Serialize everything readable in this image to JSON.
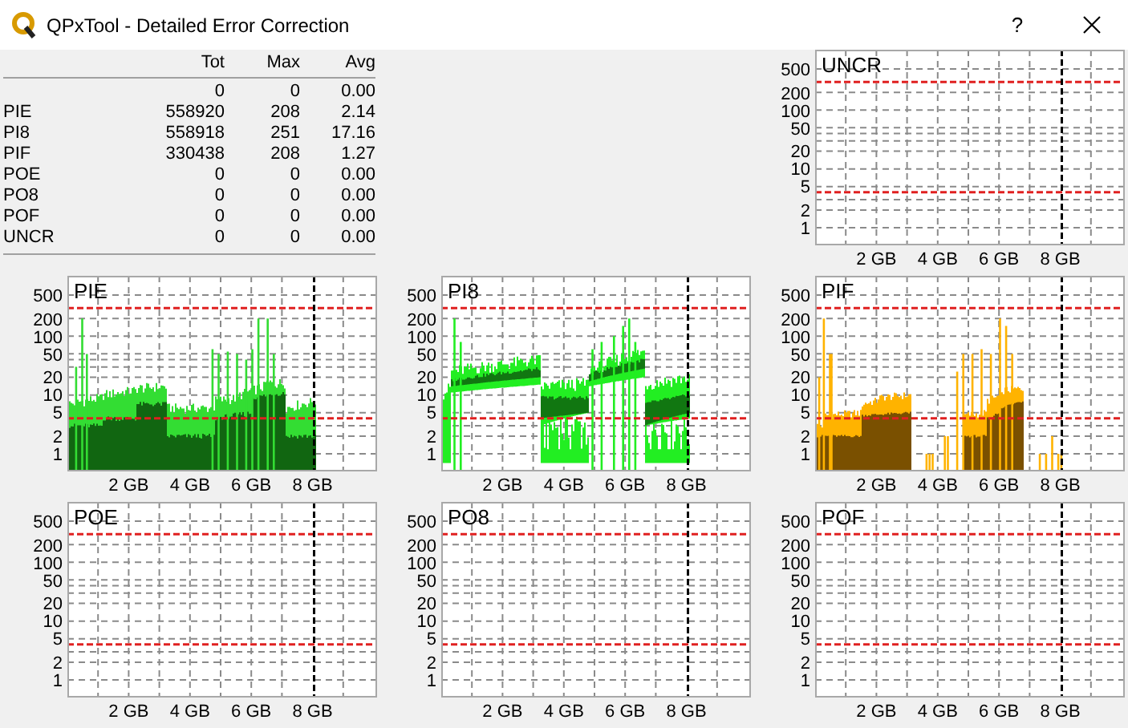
{
  "window": {
    "title": "QPxTool - Detailed Error Correction",
    "help": "?"
  },
  "summary": {
    "columns": [
      "Tot",
      "Max",
      "Avg"
    ],
    "rows": [
      {
        "tot": "0",
        "max": "0",
        "avg": "0.00"
      },
      {
        "label": "PIE",
        "tot": "558920",
        "max": "208",
        "avg": "2.14"
      },
      {
        "label": "PI8",
        "tot": "558918",
        "max": "251",
        "avg": "17.16"
      },
      {
        "label": "PIF",
        "tot": "330438",
        "max": "208",
        "avg": "1.27"
      },
      {
        "label": "POE",
        "tot": "0",
        "max": "0",
        "avg": "0.00"
      },
      {
        "label": "PO8",
        "tot": "0",
        "max": "0",
        "avg": "0.00"
      },
      {
        "label": "POF",
        "tot": "0",
        "max": "0",
        "avg": "0.00"
      },
      {
        "label": "UNCR",
        "tot": "0",
        "max": "0",
        "avg": "0.00"
      }
    ]
  },
  "charts": [
    {
      "title": "UNCR",
      "kind": "empty",
      "yticks": [
        "500",
        "200",
        "100",
        "50",
        "20",
        "10",
        "5",
        "2",
        "1"
      ],
      "xticks": [
        "2 GB",
        "4 GB",
        "6 GB",
        "8 GB"
      ]
    },
    {
      "title": "PIE",
      "kind": "pie",
      "yticks": [
        "500",
        "200",
        "100",
        "50",
        "20",
        "10",
        "5",
        "2",
        "1"
      ],
      "xticks": [
        "2 GB",
        "4 GB",
        "6 GB",
        "8 GB"
      ]
    },
    {
      "title": "PI8",
      "kind": "pi8",
      "yticks": [
        "500",
        "200",
        "100",
        "50",
        "20",
        "10",
        "5",
        "2",
        "1"
      ],
      "xticks": [
        "2 GB",
        "4 GB",
        "6 GB",
        "8 GB"
      ]
    },
    {
      "title": "PIF",
      "kind": "pif",
      "yticks": [
        "500",
        "200",
        "100",
        "50",
        "20",
        "10",
        "5",
        "2",
        "1"
      ],
      "xticks": [
        "2 GB",
        "4 GB",
        "6 GB",
        "8 GB"
      ]
    },
    {
      "title": "POE",
      "kind": "empty",
      "yticks": [
        "500",
        "200",
        "100",
        "50",
        "20",
        "10",
        "5",
        "2",
        "1"
      ],
      "xticks": [
        "2 GB",
        "4 GB",
        "6 GB",
        "8 GB"
      ]
    },
    {
      "title": "PO8",
      "kind": "empty",
      "yticks": [
        "500",
        "200",
        "100",
        "50",
        "20",
        "10",
        "5",
        "2",
        "1"
      ],
      "xticks": [
        "2 GB",
        "4 GB",
        "6 GB",
        "8 GB"
      ]
    },
    {
      "title": "POF",
      "kind": "empty",
      "yticks": [
        "500",
        "200",
        "100",
        "50",
        "20",
        "10",
        "5",
        "2",
        "1"
      ],
      "xticks": [
        "2 GB",
        "4 GB",
        "6 GB",
        "8 GB"
      ]
    }
  ]
}
